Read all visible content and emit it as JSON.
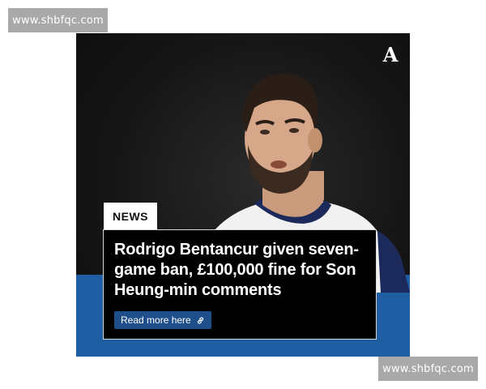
{
  "watermark": {
    "top_text": "www.shbfqc.com",
    "bottom_text": "www.shbfqc.com"
  },
  "post": {
    "logo_text": "A",
    "tag": "NEWS",
    "headline": "Rodrigo Bentancur given seven-game ban, £100,000 fine for Son Heung-min comments",
    "cta_label": "Read more here",
    "cta_icon": "link-icon"
  },
  "colors": {
    "band_blue": "#1f5ea3",
    "cta_blue": "#1f4f8a",
    "headline_bg": "#000000",
    "watermark_gray": "#a9a9a9"
  }
}
